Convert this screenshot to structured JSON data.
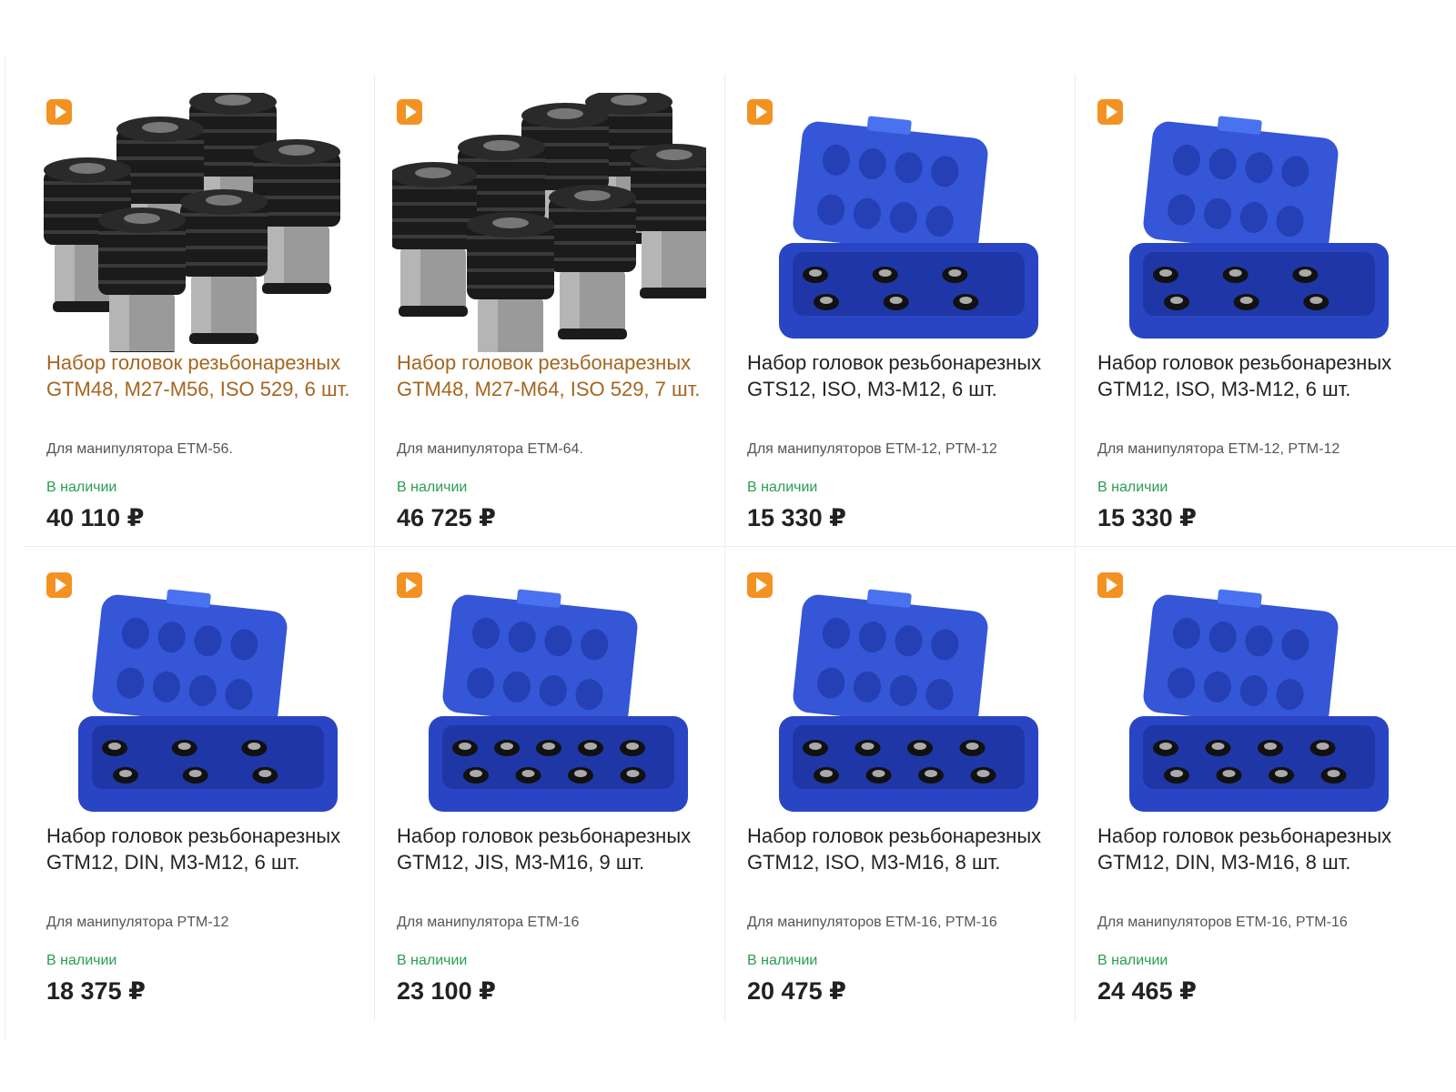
{
  "products": [
    {
      "title": "Набор головок резьбонарезных GTM48, M27-M56, ISO 529, 6 шт.",
      "desc": "Для манипулятора ETM-56.",
      "stock": "В наличии",
      "price": "40 110 ₽",
      "image": "black-tap-holders",
      "count": 6,
      "video_icon": "video-play-icon"
    },
    {
      "title": "Набор головок резьбонарезных GTM48, M27-M64, ISO 529, 7 шт.",
      "desc": "Для манипулятора ETM-64.",
      "stock": "В наличии",
      "price": "46 725 ₽",
      "image": "black-tap-holders",
      "count": 7,
      "video_icon": "video-play-icon"
    },
    {
      "title": "Набор головок резьбонарезных GTS12, ISO, M3-M12, 6 шт.",
      "desc": "Для манипуляторов ETM-12, PTM-12",
      "stock": "В наличии",
      "price": "15 330 ₽",
      "image": "blue-case-open",
      "count": 6,
      "video_icon": "video-play-icon"
    },
    {
      "title": "Набор головок резьбонарезных GTM12, ISO, M3-M12, 6 шт.",
      "desc": "Для манипулятора ETM-12, PTM-12",
      "stock": "В наличии",
      "price": "15 330 ₽",
      "image": "blue-case-open",
      "count": 6,
      "video_icon": "video-play-icon"
    },
    {
      "title": "Набор головок резьбонарезных GTM12, DIN, M3-M12, 6 шт.",
      "desc": "Для манипулятора PTM-12",
      "stock": "В наличии",
      "price": "18 375 ₽",
      "image": "blue-case-open",
      "count": 6,
      "video_icon": "video-play-icon"
    },
    {
      "title": "Набор головок резьбонарезных GTM12, JIS, M3-M16, 9 шт.",
      "desc": "Для манипулятора ETM-16",
      "stock": "В наличии",
      "price": "23 100 ₽",
      "image": "blue-case-open",
      "count": 9,
      "video_icon": "video-play-icon"
    },
    {
      "title": "Набор головок резьбонарезных GTM12, ISO, M3-M16, 8 шт.",
      "desc": "Для манипуляторов ETM-16, PTM-16",
      "stock": "В наличии",
      "price": "20 475 ₽",
      "image": "blue-case-open",
      "count": 8,
      "video_icon": "video-play-icon"
    },
    {
      "title": "Набор головок резьбонарезных GTM12, DIN, M3-M16, 8 шт.",
      "desc": "Для манипуляторов ETM-16, PTM-16",
      "stock": "В наличии",
      "price": "24 465 ₽",
      "image": "blue-case-open",
      "count": 8,
      "video_icon": "video-play-icon"
    }
  ],
  "colors": {
    "accent": "#f39222",
    "title_highlight": "#a5651f",
    "stock_green": "#2a9d4f",
    "case_blue": "#2f4fd1",
    "metal_dark": "#1b1b1b"
  }
}
